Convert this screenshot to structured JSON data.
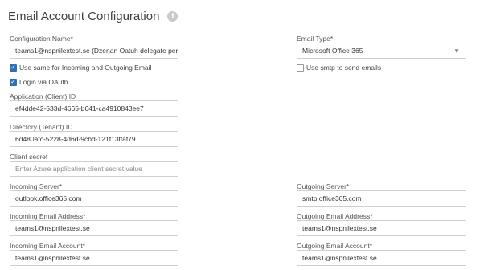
{
  "page": {
    "title": "Email Account Configuration"
  },
  "config_name": {
    "label": "Configuration Name*",
    "value": "teams1@nspnilextest.se (Dzenan Oatuh delegate per"
  },
  "email_type": {
    "label": "Email Type*",
    "selected": "Microsoft Office 365"
  },
  "options": {
    "use_same": {
      "label": "Use same for Incoming and Outgoing Email",
      "checked": true
    },
    "use_smtp": {
      "label": "Use smtp to send emails",
      "checked": false
    },
    "login_oauth": {
      "label": "Login via OAuth",
      "checked": true
    }
  },
  "client_id": {
    "label": "Application (Client) ID",
    "value": "ef4dde42-533d-4665-b641-ca4910843ee7"
  },
  "tenant_id": {
    "label": "Directory (Tenant) ID",
    "value": "6d480afc-5228-4d6d-9cbd-121f13ffaf79"
  },
  "client_secret": {
    "label": "Client secret",
    "placeholder": "Enter Azure application client secret value"
  },
  "incoming_server": {
    "label": "Incoming Server*",
    "value": "outlook.office365.com"
  },
  "outgoing_server": {
    "label": "Outgoing Server*",
    "value": "smtp.office365.com"
  },
  "incoming_address": {
    "label": "Incoming Email Address*",
    "value": "teams1@nspnilextest.se"
  },
  "outgoing_address": {
    "label": "Outgoing Email Address*",
    "value": "teams1@nspnilextest.se"
  },
  "incoming_account": {
    "label": "Incoming Email Account*",
    "value": "teams1@nspnilextest.se"
  },
  "outgoing_account": {
    "label": "Outgoing Email Account*",
    "value": "teams1@nspnilextest.se"
  }
}
